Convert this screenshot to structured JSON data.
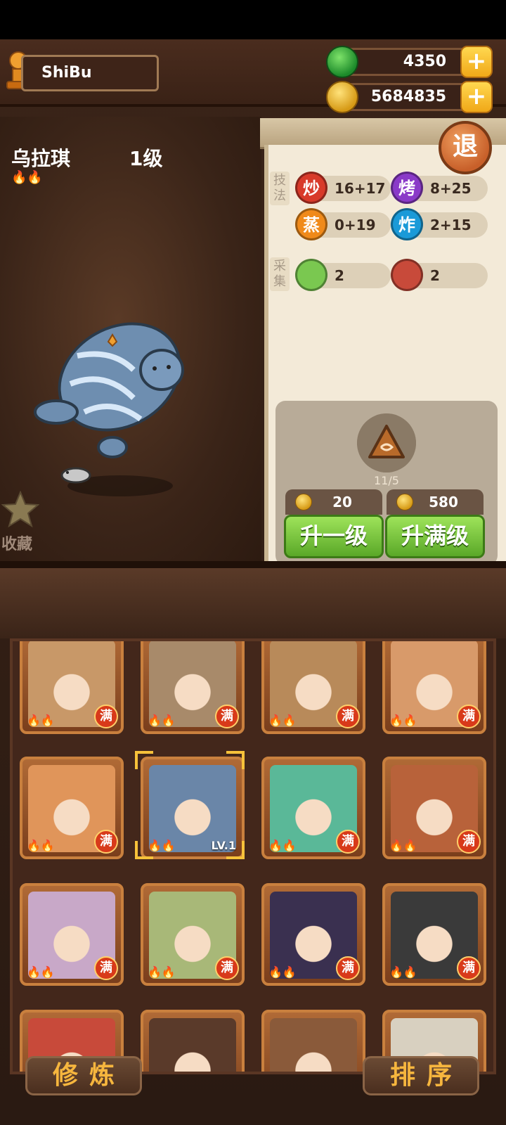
{
  "player": {
    "name": "ShiBu"
  },
  "resources": {
    "gems": "4350",
    "coins": "5684835",
    "add_symbol": "+"
  },
  "pet": {
    "name": "乌拉琪",
    "level": "1级",
    "flames": "🔥🔥"
  },
  "favorite": {
    "label": "收藏"
  },
  "exit": {
    "label": "退"
  },
  "skills": {
    "section_label": "技法",
    "items": [
      {
        "icon_text": "炒",
        "value": "16+17",
        "color": "#d83a2a"
      },
      {
        "icon_text": "烤",
        "value": "8+25",
        "color": "#8a3ac8"
      },
      {
        "icon_text": "蒸",
        "value": "0+19",
        "color": "#f08a1a"
      },
      {
        "icon_text": "炸",
        "value": "2+15",
        "color": "#1a9ad8"
      }
    ]
  },
  "gather": {
    "section_label": "采集",
    "items": [
      {
        "icon": "cabbage-icon",
        "value": "2"
      },
      {
        "icon": "meat-icon",
        "value": "2"
      }
    ]
  },
  "upgrade": {
    "ingredient_count": "11/5",
    "one": {
      "cost": "20",
      "label": "升一级"
    },
    "max": {
      "cost": "580",
      "label": "升满级"
    }
  },
  "roster": {
    "full_badge": "满",
    "selected_level": "LV.1",
    "cards": [
      {
        "color": "#c89868"
      },
      {
        "color": "#a88a6a"
      },
      {
        "color": "#b88a5a"
      },
      {
        "color": "#d89a6a"
      },
      {
        "color": "#e0955a"
      },
      {
        "color": "#6a86a8"
      },
      {
        "color": "#5ab898"
      },
      {
        "color": "#b8623a"
      },
      {
        "color": "#c8a8c8"
      },
      {
        "color": "#a8b878"
      },
      {
        "color": "#3a3050"
      },
      {
        "color": "#3a3a3a"
      },
      {
        "color": "#c84a3a"
      },
      {
        "color": "#5a3a2a"
      },
      {
        "color": "#8a5a3a"
      },
      {
        "color": "#d8d0c0"
      }
    ]
  },
  "bottom": {
    "train_label": "修炼",
    "sort_label": "排序"
  }
}
